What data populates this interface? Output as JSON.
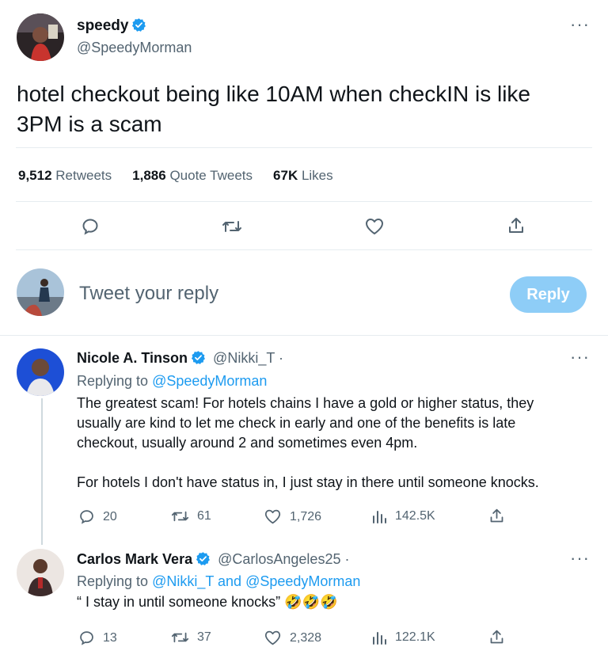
{
  "main_tweet": {
    "display_name": "speedy",
    "handle": "@SpeedyMorman",
    "text_line1": "hotel checkout being like 10AM when checkIN is like",
    "text_line2": "3PM is a scam",
    "stats": {
      "retweets_count": "9,512",
      "retweets_label": "Retweets",
      "quotes_count": "1,886",
      "quotes_label": "Quote Tweets",
      "likes_count": "67K",
      "likes_label": "Likes"
    },
    "more_label": "···"
  },
  "compose": {
    "placeholder": "Tweet your reply",
    "button_label": "Reply"
  },
  "replies": [
    {
      "display_name": "Nicole A. Tinson",
      "handle": "@Nikki_T",
      "separator": "·",
      "replying_prefix": "Replying to",
      "replying_to": "@SpeedyMorman",
      "lines": [
        "The greatest scam! For hotels chains I have a gold or higher status, they",
        "usually are kind to let me check in early and one of the benefits is late",
        "checkout, usually around 2 and sometimes even 4pm.",
        "For hotels I don't have status in, I just stay in there until someone knocks."
      ],
      "counts": {
        "replies": "20",
        "retweets": "61",
        "likes": "1,726",
        "views": "142.5K"
      },
      "more_label": "···"
    },
    {
      "display_name": "Carlos Mark Vera",
      "handle": "@CarlosAngeles25",
      "separator": "·",
      "replying_prefix": "Replying to",
      "replying_to": "@Nikki_T and @SpeedyMorman",
      "lines": [
        "“ I stay in until someone knocks”"
      ],
      "emoji": "🤣🤣🤣",
      "counts": {
        "replies": "13",
        "retweets": "37",
        "likes": "2,328",
        "views": "122.1K"
      },
      "more_label": "···"
    }
  ],
  "colors": {
    "accent": "#1d9bf0",
    "reply_button": "#8ecdf7",
    "muted": "#536471",
    "divider": "#e6ecf0"
  },
  "icons": [
    "verified-badge-icon",
    "reply-icon",
    "retweet-icon",
    "like-icon",
    "share-icon",
    "views-icon",
    "more-icon"
  ]
}
